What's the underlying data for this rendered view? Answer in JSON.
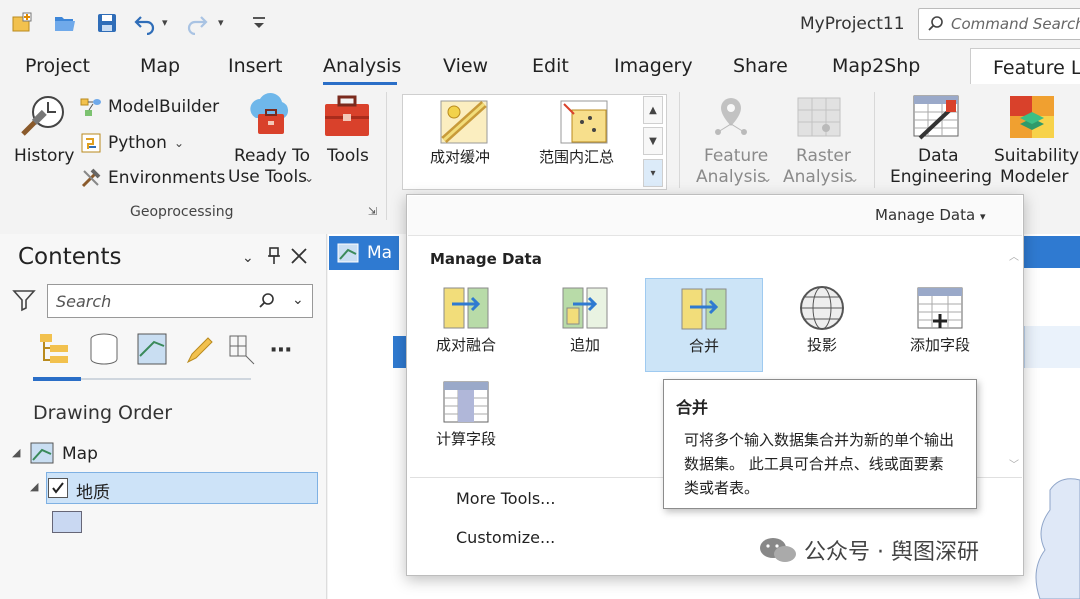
{
  "project_title": "MyProject11",
  "command_search": {
    "placeholder": "Command Search"
  },
  "tabs": [
    {
      "label": "Project"
    },
    {
      "label": "Map"
    },
    {
      "label": "Insert"
    },
    {
      "label": "Analysis"
    },
    {
      "label": "View"
    },
    {
      "label": "Edit"
    },
    {
      "label": "Imagery"
    },
    {
      "label": "Share"
    },
    {
      "label": "Map2Shp"
    },
    {
      "label": "Feature La"
    }
  ],
  "ribbon": {
    "history": "History",
    "modelbuilder": "ModelBuilder",
    "python": "Python",
    "environments": "Environments",
    "ready_to_use_1": "Ready To",
    "ready_to_use_2": "Use Tools",
    "tools": "Tools",
    "group_geoprocessing": "Geoprocessing",
    "gallery_tool_1": "成对缓冲",
    "gallery_tool_2": "范围内汇总",
    "feature_analysis_1": "Feature",
    "feature_analysis_2": "Analysis",
    "raster_analysis_1": "Raster",
    "raster_analysis_2": "Analysis",
    "data_engineering_1": "Data",
    "data_engineering_2": "Engineering",
    "suitability_1": "Suitability",
    "suitability_2": "Modeler"
  },
  "contents": {
    "title": "Contents",
    "search_placeholder": "Search",
    "drawing_order": "Drawing Order",
    "map_node": "Map",
    "layer": "地质"
  },
  "map_tab": "Ma",
  "dropdown": {
    "filter": "Manage Data",
    "section_title": "Manage Data",
    "tools": [
      {
        "label": "成对融合"
      },
      {
        "label": "追加"
      },
      {
        "label": "合并"
      },
      {
        "label": "投影"
      },
      {
        "label": "添加字段"
      },
      {
        "label": "计算字段"
      }
    ],
    "more_tools": "More Tools...",
    "customize": "Customize..."
  },
  "tooltip": {
    "title": "合并",
    "description": "可将多个输入数据集合并为新的单个输出数据集。 此工具可合并点、线或面要素类或者表。"
  },
  "watermark": "公众号 · 舆图深研",
  "colors": {
    "accent": "#2a6ec7",
    "selection": "#cce4f7"
  }
}
